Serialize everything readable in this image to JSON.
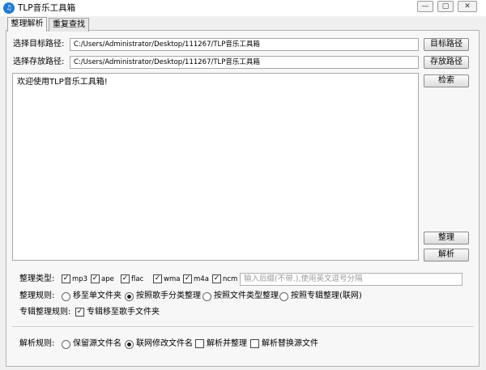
{
  "window": {
    "title": "TLP音乐工具箱",
    "icon_glyph": "♫",
    "minimize_glyph": "—",
    "maximize_glyph": "▢",
    "close_glyph": "✕"
  },
  "tabs": [
    {
      "label": "整理解析",
      "active": true
    },
    {
      "label": "重复查找",
      "active": false
    }
  ],
  "target_path": {
    "label": "选择目标路径:",
    "value": "C:/Users/Administrator/Desktop/111267/TLP音乐工具箱",
    "button": "目标路径"
  },
  "save_path": {
    "label": "选择存放路径:",
    "value": "C:/Users/Administrator/Desktop/111267/TLP音乐工具箱",
    "button": "存放路径"
  },
  "log": {
    "text": "欢迎使用TLP音乐工具箱!"
  },
  "side_buttons": {
    "search": "检索",
    "organize": "整理",
    "parse": "解析"
  },
  "organize_type": {
    "label": "整理类型:",
    "options": [
      {
        "label": "mp3",
        "checked": true
      },
      {
        "label": "ape",
        "checked": true
      },
      {
        "label": "flac",
        "checked": true
      },
      {
        "label": "wma",
        "checked": true
      },
      {
        "label": "m4a",
        "checked": true
      },
      {
        "label": "ncm",
        "checked": true
      }
    ],
    "placeholder": "输入后缀(不带.),使用英文逗号分隔"
  },
  "organize_rule": {
    "label": "整理规则:",
    "options": [
      {
        "label": "移至单文件夹",
        "selected": false
      },
      {
        "label": "按照歌手分类整理",
        "selected": true
      },
      {
        "label": "按照文件类型整理",
        "selected": false
      },
      {
        "label": "按照专辑整理(联网)",
        "selected": false
      }
    ]
  },
  "album_rule": {
    "label": "专辑整理规则:",
    "option": {
      "label": "专辑移至歌手文件夹",
      "checked": true
    }
  },
  "parse_rule": {
    "label": "解析规则:",
    "radios": [
      {
        "label": "保留源文件名",
        "selected": false
      },
      {
        "label": "联网修改文件名",
        "selected": true
      }
    ],
    "checks": [
      {
        "label": "解析并整理",
        "checked": false
      },
      {
        "label": "解析替换源文件",
        "checked": false
      }
    ]
  },
  "check_glyph": "✓"
}
